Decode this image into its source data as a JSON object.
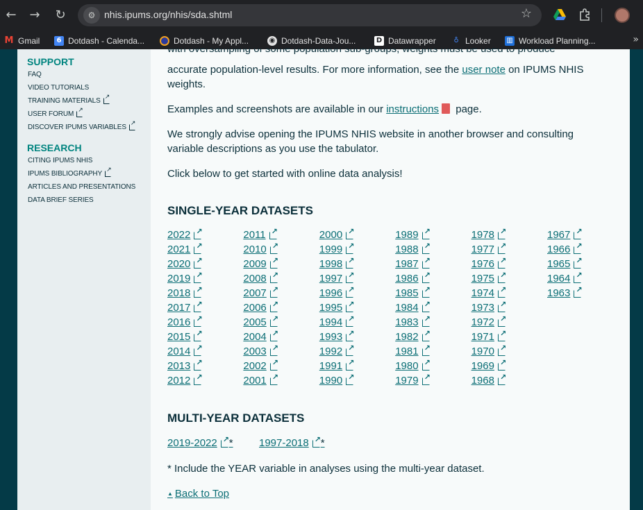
{
  "browser": {
    "url_domain": "nhis.ipums.org",
    "url_path": "/nhis/sda.shtml",
    "bookmarks": [
      "Gmail",
      "Dotdash - Calenda...",
      "Dotdash - My Appl...",
      "Dotdash-Data-Jou...",
      "Datawrapper",
      "Looker",
      "Workload Planning..."
    ]
  },
  "sidebar": {
    "support_heading": "SUPPORT",
    "support_items": [
      {
        "label": "FAQ",
        "external": false
      },
      {
        "label": "VIDEO TUTORIALS",
        "external": false
      },
      {
        "label": "TRAINING MATERIALS",
        "external": true
      },
      {
        "label": "USER FORUM",
        "external": true
      },
      {
        "label": "DISCOVER IPUMS VARIABLES",
        "external": true
      }
    ],
    "research_heading": "RESEARCH",
    "research_items": [
      {
        "label": "CITING IPUMS NHIS",
        "external": false
      },
      {
        "label": "IPUMS BIBLIOGRAPHY",
        "external": true
      },
      {
        "label": "ARTICLES AND PRESENTATIONS",
        "external": false
      },
      {
        "label": "DATA BRIEF SERIES",
        "external": false
      }
    ]
  },
  "main": {
    "para1_top": "with oversampling of some population sub-groups, weights must be used to produce",
    "para1_mid": "accurate population-level results. For more information, see the ",
    "para1_link": "user note",
    "para1_after": " on IPUMS NHIS",
    "para1_end": "weights.",
    "para2_before": "Examples and screenshots are available in our ",
    "para2_link": "instructions",
    "para2_after": " page.",
    "para3": "We strongly advise opening the IPUMS NHIS website in another browser and consulting variable descriptions as you use the tabulator.",
    "para4": "Click below to get started with online data analysis!",
    "single_heading": "SINGLE-YEAR DATASETS",
    "single_years": [
      [
        "2022",
        "2021",
        "2020",
        "2019",
        "2018",
        "2017",
        "2016",
        "2015",
        "2014",
        "2013",
        "2012"
      ],
      [
        "2011",
        "2010",
        "2009",
        "2008",
        "2007",
        "2006",
        "2005",
        "2004",
        "2003",
        "2002",
        "2001"
      ],
      [
        "2000",
        "1999",
        "1998",
        "1997",
        "1996",
        "1995",
        "1994",
        "1993",
        "1992",
        "1991",
        "1990"
      ],
      [
        "1989",
        "1988",
        "1987",
        "1986",
        "1985",
        "1984",
        "1983",
        "1982",
        "1981",
        "1980",
        "1979"
      ],
      [
        "1978",
        "1977",
        "1976",
        "1975",
        "1974",
        "1973",
        "1972",
        "1971",
        "1970",
        "1969",
        "1968"
      ],
      [
        "1967",
        "1966",
        "1965",
        "1964",
        "1963"
      ]
    ],
    "multi_heading": "MULTI-YEAR DATASETS",
    "multi_years": [
      {
        "label": "2019-2022",
        "suffix": "*"
      },
      {
        "label": "1997-2018",
        "suffix": "*"
      }
    ],
    "multi_note": "* Include the YEAR variable in analyses using the multi-year dataset.",
    "back_to_top": "Back to Top"
  }
}
